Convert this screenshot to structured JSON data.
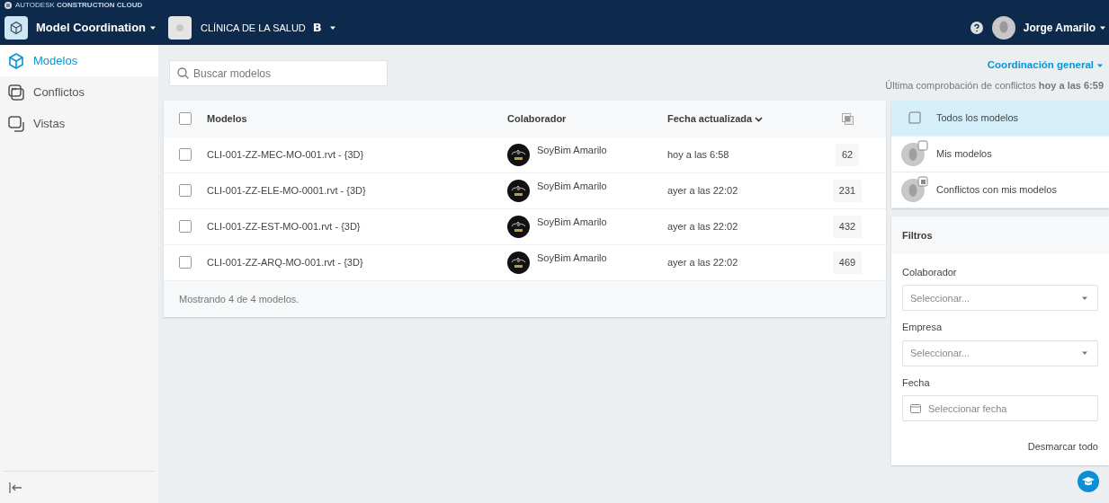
{
  "header": {
    "brand": "AUTODESK **CONSTRUCTION CLOUD**",
    "app_name": "Model Coordination",
    "project_name": "CLÍNICA DE LA SALUD",
    "project_badge": "B",
    "user_name": "Jorge Amarilo"
  },
  "sidebar": {
    "items": [
      {
        "label": "Modelos",
        "kind": "models",
        "selected": true
      },
      {
        "label": "Conflictos",
        "kind": "clashes",
        "selected": false
      },
      {
        "label": "Vistas",
        "kind": "views",
        "selected": false
      }
    ]
  },
  "search": {
    "placeholder": "Buscar modelos"
  },
  "coordination": {
    "label": "Coordinación general",
    "last_check": "Última comprobación de conflictos **hoy a las 6:59**"
  },
  "table": {
    "all_checked": false,
    "columns": [
      {
        "label": "Modelos",
        "kind": "text"
      },
      {
        "label": "Colaborador",
        "kind": "text"
      },
      {
        "label": "Fecha actualizada",
        "kind": "sort"
      },
      {
        "kind": "icon"
      }
    ],
    "rows": [
      {
        "checked": false,
        "name": "CLI-001-ZZ-MEC-MO-001.rvt - {3D}",
        "collaborator": "SoyBim Amarilo",
        "date": "hoy a las 6:58",
        "count": "62"
      },
      {
        "checked": false,
        "name": "CLI-001-ZZ-ELE-MO-0001.rvt - {3D}",
        "collaborator": "SoyBim Amarilo",
        "date": "ayer a las 22:02",
        "count": "231"
      },
      {
        "checked": false,
        "name": "CLI-001-ZZ-EST-MO-001.rvt - {3D}",
        "collaborator": "SoyBim Amarilo",
        "date": "ayer a las 22:02",
        "count": "432"
      },
      {
        "checked": false,
        "name": "CLI-001-ZZ-ARQ-MO-001.rvt - {3D}",
        "collaborator": "SoyBim Amarilo",
        "date": "ayer a las 22:02",
        "count": "469"
      }
    ],
    "footer": "Mostrando 4 de 4 modelos."
  },
  "scopes": [
    {
      "label": "Todos los modelos",
      "kind": "all",
      "selected": true
    },
    {
      "label": "Mis modelos",
      "kind": "mine",
      "selected": false
    },
    {
      "label": "Conflictos con mis modelos",
      "kind": "conflicts",
      "selected": false
    }
  ],
  "filters": {
    "title": "Filtros",
    "fields": [
      {
        "label": "Colaborador",
        "kind": "select",
        "placeholder": "Seleccionar..."
      },
      {
        "label": "Empresa",
        "kind": "select",
        "placeholder": "Seleccionar..."
      },
      {
        "label": "Fecha",
        "kind": "date",
        "placeholder": "Seleccionar fecha"
      }
    ],
    "clear": "Desmarcar todo"
  }
}
